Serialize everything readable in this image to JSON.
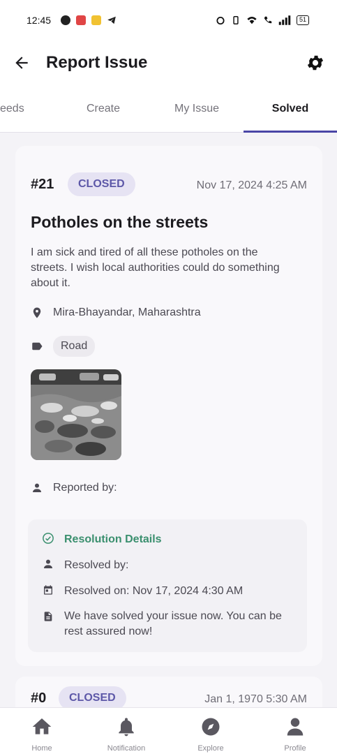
{
  "status_bar": {
    "time": "12:45",
    "battery": "51"
  },
  "app_bar": {
    "title": "Report Issue",
    "back_icon": "arrow-left-icon",
    "settings_icon": "gear-icon"
  },
  "tabs": [
    {
      "label": "eeds"
    },
    {
      "label": "Create"
    },
    {
      "label": "My Issue"
    },
    {
      "label": "Solved",
      "active": true
    }
  ],
  "issues": [
    {
      "number": "#21",
      "status": "CLOSED",
      "date": "Nov 17, 2024 4:25 AM",
      "title": "Potholes on the streets",
      "description": "I am sick and tired of all these potholes on the streets. I wish local authorities could  do something about it.",
      "location": "Mira-Bhayandar, Maharashtra",
      "tag": "Road",
      "reported_by_label": "Reported by:",
      "resolution": {
        "title": "Resolution Details",
        "resolved_by_label": "Resolved by:",
        "resolved_on": "Resolved on: Nov 17, 2024 4:30 AM",
        "note": "We have solved your issue now. You can be rest assured now!"
      }
    },
    {
      "number": "#0",
      "status": "CLOSED",
      "date": "Jan 1, 1970 5:30 AM"
    }
  ],
  "bottom_nav": [
    {
      "label": "Home",
      "icon": "home-icon"
    },
    {
      "label": "Notification",
      "icon": "bell-icon"
    },
    {
      "label": "Explore",
      "icon": "compass-icon"
    },
    {
      "label": "Profile",
      "icon": "person-icon"
    }
  ],
  "colors": {
    "accent": "#4a45a6",
    "badge_bg": "#e6e3f3",
    "badge_text": "#5d58a8",
    "resolution_green": "#3a8f6e"
  }
}
